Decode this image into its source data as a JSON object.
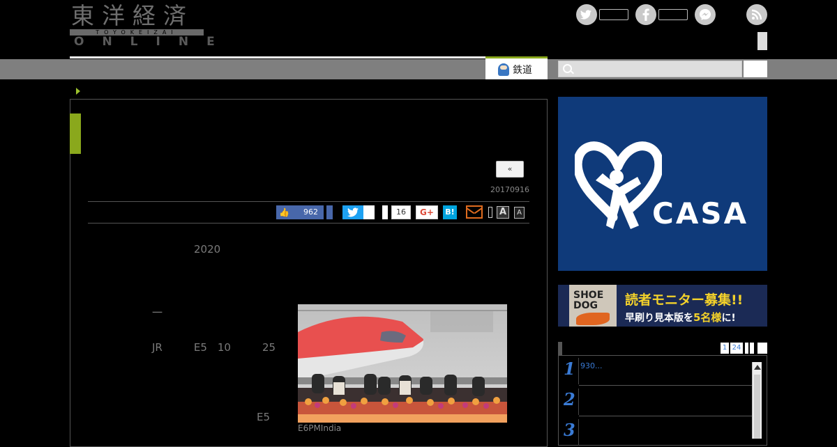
{
  "header": {
    "logo_kanji": "東洋経済",
    "logo_band": "TOYOKEIZAI",
    "logo_online": "ONLINE",
    "social": {
      "twitter_glyph": "t",
      "facebook_glyph": "f",
      "messenger_glyph": "m",
      "rss_glyph": "rss"
    }
  },
  "nav": {
    "active_tab_label": "鉄道"
  },
  "article": {
    "prev_label": "«",
    "date": "20170916",
    "share": {
      "like_count": "962",
      "pocket_count": "16",
      "gplus_label": "G+",
      "hatena_label": "B!",
      "font_large": "A",
      "font_small": "A"
    },
    "paragraph1": "　　　　　　　　2020",
    "paragraph2_lines": [
      "　　　　一",
      "",
      "　　　　JR　　　E5　10　　　25",
      "",
      "",
      "",
      "　　　　　　　　　　　　　　E5",
      ""
    ],
    "photo_caption": "E6PMIndia"
  },
  "sidebar": {
    "ad_casa_label": "CASA",
    "ad_casa_reg": "®",
    "ad_book_title": "SHOE DOG",
    "ad_book_line1": "読者モニター募集!!",
    "ad_book_line2_pre": "早刷り見本版を",
    "ad_book_line2_em": "5名様",
    "ad_book_line2_post": "に!",
    "ranking_tabs": [
      "1",
      "24",
      "",
      "",
      ""
    ],
    "ranking": [
      {
        "rank": "1",
        "text": "930..."
      },
      {
        "rank": "2",
        "text": ""
      },
      {
        "rank": "3",
        "text": ""
      }
    ]
  },
  "colors": {
    "accent_green": "#8aa81c",
    "link_blue": "#3a7bd5",
    "facebook_blue": "#4867aa",
    "twitter_blue": "#1da1f2",
    "casa_blue": "#0f3a7a"
  }
}
